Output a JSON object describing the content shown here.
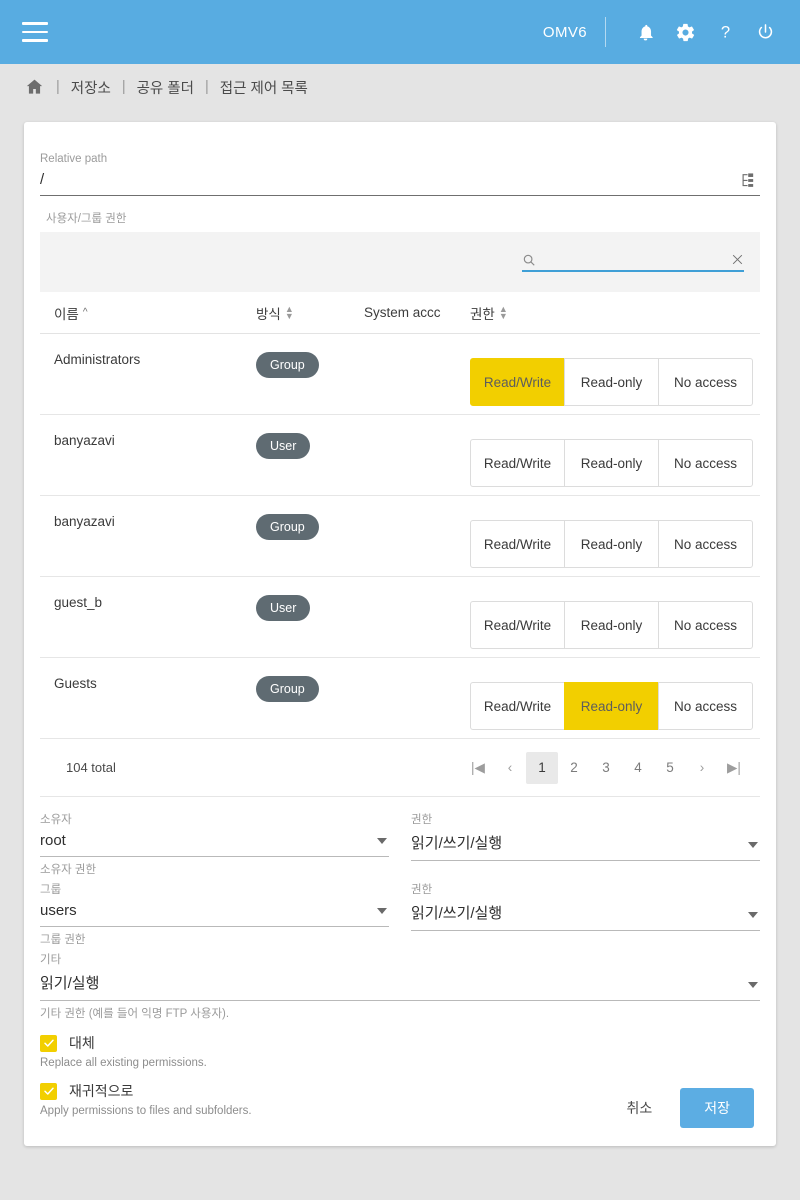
{
  "appbar": {
    "menu_icon": "hamburger-icon",
    "brand": "OMV6",
    "icons": [
      {
        "name": "notifications-icon",
        "glyph": "bell"
      },
      {
        "name": "settings-icon",
        "glyph": "gear"
      },
      {
        "name": "help-icon",
        "glyph": "question-mark"
      },
      {
        "name": "power-icon",
        "glyph": "power"
      }
    ],
    "accent_color": "#58ace1"
  },
  "breadcrumb": {
    "home_icon": "home-icon",
    "separator": "|",
    "items": [
      "저장소",
      "공유 폴더",
      "접근 제어 목록"
    ]
  },
  "form": {
    "relative_path_label": "Relative path",
    "relative_path_value": "/",
    "tree_icon": "folder-tree-icon",
    "user_group_perms_label": "사용자/그룹 권한"
  },
  "table": {
    "search": {
      "value": "",
      "placeholder": "",
      "search_icon": "search-icon",
      "clear_icon": "close-icon"
    },
    "columns": [
      {
        "key": "name",
        "label": "이름",
        "sort": "asc"
      },
      {
        "key": "type",
        "label": "방식",
        "sort": "none"
      },
      {
        "key": "system",
        "label": "System accc",
        "sort": "none"
      },
      {
        "key": "perm",
        "label": "권한",
        "sort": "none"
      }
    ],
    "permission_options": [
      "Read/Write",
      "Read-only",
      "No access"
    ],
    "rows": [
      {
        "name": "Administrators",
        "type": "Group",
        "system": "",
        "selected": "Read/Write"
      },
      {
        "name": "banyazavi",
        "type": "User",
        "system": "",
        "selected": ""
      },
      {
        "name": "banyazavi",
        "type": "Group",
        "system": "",
        "selected": ""
      },
      {
        "name": "guest_b",
        "type": "User",
        "system": "",
        "selected": ""
      },
      {
        "name": "Guests",
        "type": "Group",
        "system": "",
        "selected": "Read-only"
      }
    ],
    "total_label": "104 total",
    "pagination": {
      "first_label": "|◀",
      "prev_label": "‹",
      "pages": [
        "1",
        "2",
        "3",
        "4",
        "5"
      ],
      "active_page": "1",
      "next_label": "›",
      "last_label": "▶|"
    },
    "selected_color": "#f2cf00"
  },
  "permissions": {
    "owner_label": "소유자",
    "owner_value": "root",
    "owner_perm_label": "권한",
    "owner_perm_value": "읽기/쓰기/실행",
    "owner_hint": "소유자 권한",
    "group_label": "그룹",
    "group_value": "users",
    "group_perm_label": "권한",
    "group_perm_value": "읽기/쓰기/실행",
    "group_hint": "그룹 권한",
    "other_label": "기타",
    "other_value": "읽기/실행",
    "other_hint": "기타 권한 (예를 들어 익명 FTP 사용자).",
    "replace_label": "대체",
    "replace_hint": "Replace all existing permissions.",
    "replace_checked": true,
    "recursive_label": "재귀적으로",
    "recursive_hint": "Apply permissions to files and subfolders.",
    "recursive_checked": true
  },
  "actions": {
    "cancel_label": "취소",
    "save_label": "저장",
    "save_color": "#5cade3"
  }
}
